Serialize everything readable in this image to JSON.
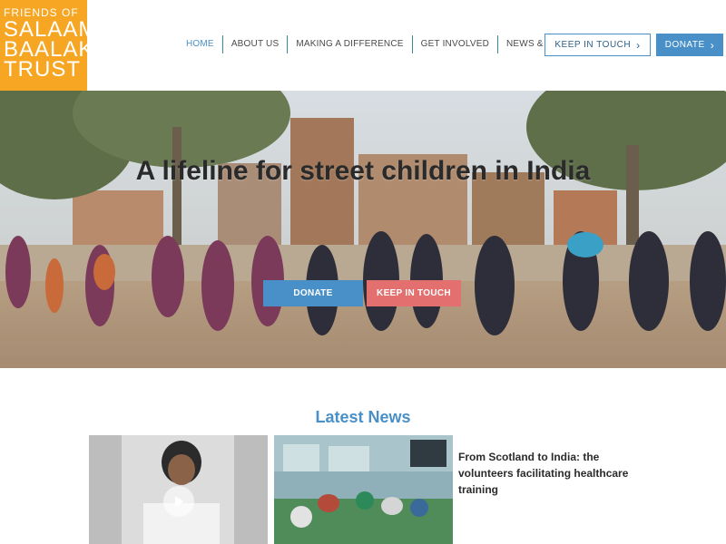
{
  "logo": {
    "line1": "FRIENDS OF",
    "line2": "SALAAM",
    "line3": "BAALAK",
    "line4": "TRUST"
  },
  "nav": {
    "items": [
      {
        "label": "HOME",
        "active": true
      },
      {
        "label": "ABOUT US",
        "active": false
      },
      {
        "label": "MAKING A DIFFERENCE",
        "active": false
      },
      {
        "label": "GET INVOLVED",
        "active": false
      },
      {
        "label": "NEWS & UPDATES",
        "active": false
      }
    ],
    "keep_in_touch": "KEEP IN TOUCH",
    "donate": "DONATE",
    "chevron": "›"
  },
  "hero": {
    "title": "A lifeline for street children in India",
    "donate_label": "DONATE",
    "keep_label": "KEEP IN TOUCH"
  },
  "news": {
    "heading": "Latest News",
    "headline": "From Scotland to India: the volunteers facilitating healthcare training",
    "play_icon": "play-icon"
  },
  "colors": {
    "accent": "#4a90c8",
    "logo_bg": "#f6a623",
    "keep_btn": "#e36f6f"
  }
}
